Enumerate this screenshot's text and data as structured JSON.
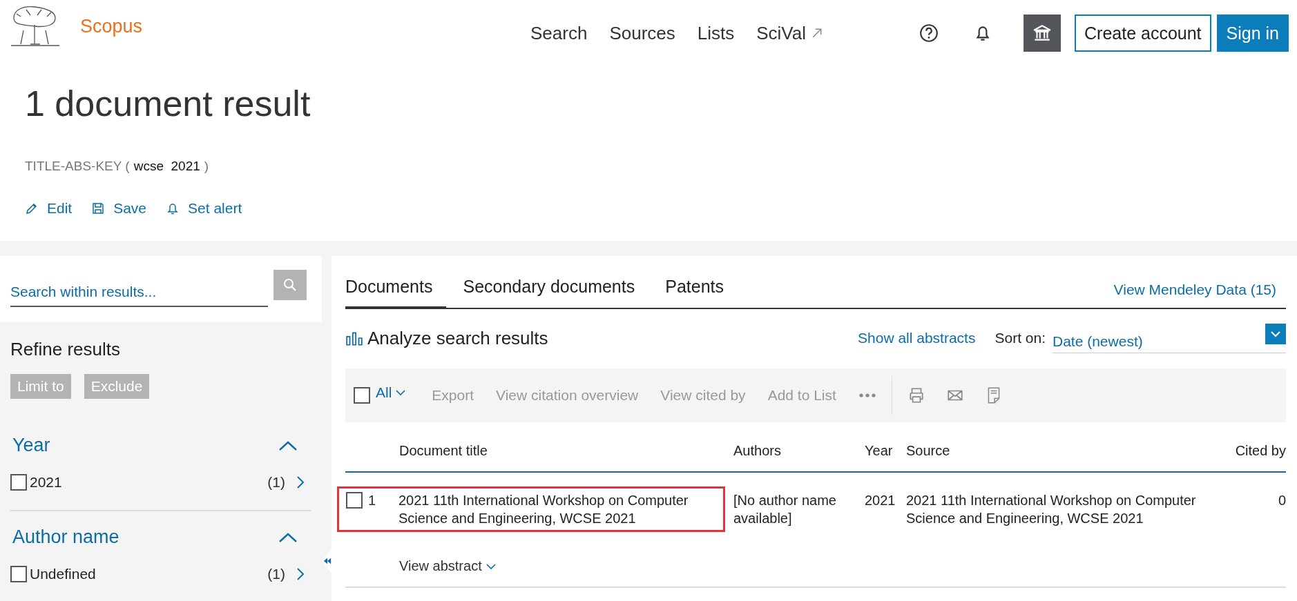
{
  "header": {
    "logo_text": "Scopus",
    "nav": [
      {
        "label": "Search",
        "external": false
      },
      {
        "label": "Sources",
        "external": false
      },
      {
        "label": "Lists",
        "external": false
      },
      {
        "label": "SciVal",
        "external": true
      }
    ],
    "create_account": "Create account",
    "sign_in": "Sign in"
  },
  "page_title": "1 document result",
  "query": {
    "field": "TITLE-ABS-KEY (",
    "terms": "wcse  2021",
    "close": ")"
  },
  "query_actions": [
    {
      "kind": "edit",
      "label": "Edit"
    },
    {
      "kind": "save",
      "label": "Save"
    },
    {
      "kind": "alert",
      "label": "Set alert"
    }
  ],
  "sidebar": {
    "search": {
      "placeholder": "Search within results..."
    },
    "title": "Refine results",
    "buttons": [
      "Limit to",
      "Exclude"
    ],
    "facets": [
      {
        "title": "Year",
        "expanded": true,
        "items": [
          {
            "label": "2021",
            "count": "(1)",
            "checked": false
          }
        ]
      },
      {
        "title": "Author name",
        "expanded": true,
        "items": [
          {
            "label": "Undefined",
            "count": "(1)",
            "checked": false
          }
        ]
      }
    ]
  },
  "results": {
    "tabs": [
      {
        "label": "Documents",
        "selected": true
      },
      {
        "label": "Secondary documents",
        "selected": false
      },
      {
        "label": "Patents",
        "selected": false
      }
    ],
    "mendeley_link": "View Mendeley Data (15)",
    "analyze": "Analyze search results",
    "show_all_abstracts": "Show all abstracts",
    "sort": {
      "label": "Sort on:",
      "value": "Date (newest)"
    },
    "toolbar": {
      "select_all": {
        "label": "All",
        "checked": false
      },
      "actions": [
        "Export",
        "View citation overview",
        "View cited by",
        "Add to List"
      ]
    },
    "columns": [
      "Document title",
      "Authors",
      "Year",
      "Source",
      "Cited by"
    ],
    "rows": [
      {
        "number": "1",
        "checked": false,
        "highlighted": true,
        "title": "2021 11th International Workshop on Computer Science and Engineering, WCSE 2021",
        "authors": "[No author name available]",
        "year": "2021",
        "source": "2021 11th International Workshop on Computer Science and Engineering, WCSE 2021",
        "cited_by": "0",
        "view_abstract": "View abstract"
      }
    ]
  }
}
